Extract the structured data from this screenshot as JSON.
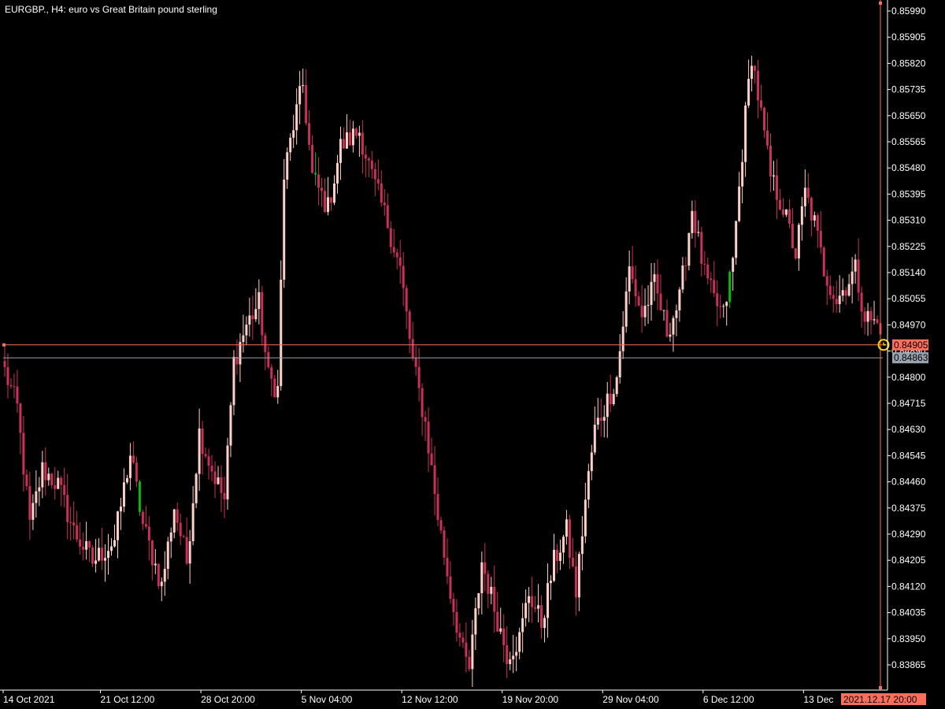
{
  "window": {
    "title": "EURGBP., H4:  euro vs Great Britain pound sterling"
  },
  "colors": {
    "background": "#000000",
    "axis": "#ffffff",
    "bull_candle": "#ffd0c8",
    "bear_candle": "#c8325a",
    "highlight_candle": "#00c000",
    "price_line_bid": "#ff6e5a",
    "price_line_ask": "#9aa3ad",
    "alert_icon": "#ffd400"
  },
  "chart_data": {
    "type": "candlestick",
    "symbol": "EURGBP.",
    "timeframe": "H4",
    "title": "euro vs Great Britain pound sterling",
    "ylim": [
      0.8381,
      0.8604
    ],
    "y_ticks": [
      "0.85990",
      "0.85905",
      "0.85820",
      "0.85735",
      "0.85650",
      "0.85565",
      "0.85480",
      "0.85395",
      "0.85310",
      "0.85225",
      "0.85140",
      "0.85055",
      "0.84970",
      "0.84890",
      "0.84800",
      "0.84715",
      "0.84630",
      "0.84545",
      "0.84460",
      "0.84375",
      "0.84290",
      "0.84205",
      "0.84120",
      "0.84035",
      "0.83950",
      "0.83865"
    ],
    "x_ticks": [
      "14 Oct 2021",
      "21 Oct 12:00",
      "28 Oct 20:00",
      "5 Nov 04:00",
      "12 Nov 12:00",
      "19 Nov 20:00",
      "29 Nov 04:00",
      "6 Dec 12:00",
      "13 Dec"
    ],
    "x_tick_bar_index": [
      0,
      31,
      63,
      95,
      127,
      159,
      191,
      223,
      255
    ],
    "current_time_label": "2021.12.17 20:00",
    "bid_price": "0.84905",
    "ask_price": "0.84863",
    "bid_value": 0.84905,
    "ask_value": 0.84863,
    "waypoints": [
      [
        0,
        0.8482
      ],
      [
        4,
        0.847
      ],
      [
        8,
        0.8432
      ],
      [
        12,
        0.845
      ],
      [
        17,
        0.8445
      ],
      [
        22,
        0.843
      ],
      [
        28,
        0.842
      ],
      [
        35,
        0.8427
      ],
      [
        40,
        0.8455
      ],
      [
        44,
        0.8432
      ],
      [
        50,
        0.8412
      ],
      [
        54,
        0.8438
      ],
      [
        58,
        0.842
      ],
      [
        62,
        0.8462
      ],
      [
        66,
        0.845
      ],
      [
        70,
        0.844
      ],
      [
        73,
        0.8485
      ],
      [
        77,
        0.8497
      ],
      [
        81,
        0.8504
      ],
      [
        84,
        0.848
      ],
      [
        87,
        0.8476
      ],
      [
        89,
        0.8545
      ],
      [
        92,
        0.8562
      ],
      [
        95,
        0.8575
      ],
      [
        98,
        0.8545
      ],
      [
        103,
        0.8535
      ],
      [
        107,
        0.8555
      ],
      [
        113,
        0.856
      ],
      [
        117,
        0.8545
      ],
      [
        122,
        0.853
      ],
      [
        126,
        0.8515
      ],
      [
        130,
        0.8485
      ],
      [
        134,
        0.8465
      ],
      [
        138,
        0.8435
      ],
      [
        142,
        0.841
      ],
      [
        146,
        0.839
      ],
      [
        148,
        0.8385
      ],
      [
        152,
        0.842
      ],
      [
        156,
        0.8405
      ],
      [
        160,
        0.839
      ],
      [
        164,
        0.8395
      ],
      [
        167,
        0.841
      ],
      [
        171,
        0.84
      ],
      [
        175,
        0.842
      ],
      [
        179,
        0.843
      ],
      [
        182,
        0.841
      ],
      [
        185,
        0.844
      ],
      [
        188,
        0.8463
      ],
      [
        191,
        0.847
      ],
      [
        195,
        0.848
      ],
      [
        199,
        0.8515
      ],
      [
        203,
        0.85
      ],
      [
        207,
        0.851
      ],
      [
        211,
        0.8495
      ],
      [
        215,
        0.8505
      ],
      [
        219,
        0.8535
      ],
      [
        223,
        0.8513
      ],
      [
        226,
        0.8505
      ],
      [
        229,
        0.85
      ],
      [
        232,
        0.8518
      ],
      [
        236,
        0.8565
      ],
      [
        238,
        0.8585
      ],
      [
        241,
        0.8565
      ],
      [
        244,
        0.8545
      ],
      [
        248,
        0.8535
      ],
      [
        252,
        0.852
      ],
      [
        255,
        0.854
      ],
      [
        258,
        0.853
      ],
      [
        261,
        0.8515
      ],
      [
        265,
        0.8505
      ],
      [
        268,
        0.851
      ],
      [
        271,
        0.8515
      ],
      [
        274,
        0.85
      ],
      [
        278,
        0.8497
      ]
    ]
  }
}
